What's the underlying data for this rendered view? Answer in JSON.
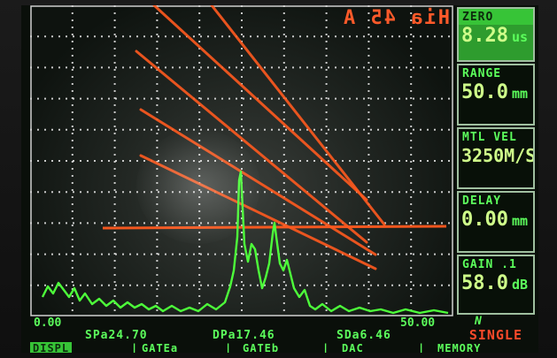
{
  "top_readout": "Hia 45 A",
  "panels": [
    {
      "label": "ZERO",
      "value": "8.28",
      "unit": "us"
    },
    {
      "label": "RANGE",
      "value": "50.0",
      "unit": "mm"
    },
    {
      "label": "MTL VEL",
      "value": "3250M/S",
      "unit": ""
    },
    {
      "label": "DELAY",
      "value": "0.00",
      "unit": "mm"
    },
    {
      "label": "GAIN .1",
      "value": "58.0",
      "unit": "dB"
    }
  ],
  "axis": {
    "start": "0.00",
    "end": "50.00",
    "marker": "N"
  },
  "status": {
    "sp": "SPa24.70",
    "dp": "DPa17.46",
    "sd": "SDa6.46",
    "mode": "SINGLE"
  },
  "menu": {
    "items": [
      "DISPL",
      "GATEa",
      "GATEb",
      "DAC",
      "MEMORY"
    ],
    "active_index": 0
  },
  "colors": {
    "trace": "#4dff3a",
    "dac_curve": "#ff5a1f",
    "grid": "#e8e8e8"
  }
}
